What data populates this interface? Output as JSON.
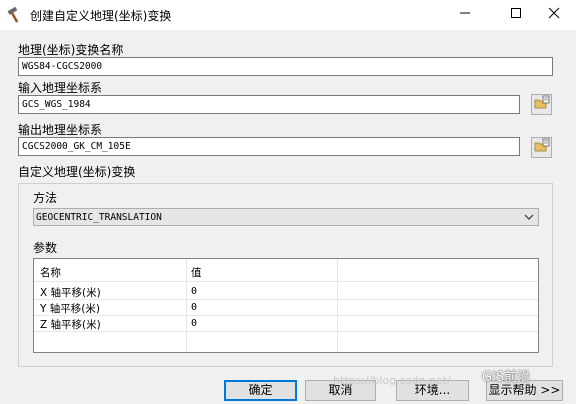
{
  "window": {
    "title": "创建自定义地理(坐标)变换"
  },
  "form": {
    "name_label": "地理(坐标)变换名称",
    "name_value": "WGS84-CGCS2000",
    "input_label": "输入地理坐标系",
    "input_value": "GCS_WGS_1984",
    "output_label": "输出地理坐标系",
    "output_value": "CGCS2000_GK_CM_105E",
    "custom_section_label": "自定义地理(坐标)变换",
    "method_label": "方法",
    "method_value": "GEOCENTRIC_TRANSLATION",
    "params_label": "参数"
  },
  "params_table": {
    "headers": [
      "名称",
      "值"
    ],
    "rows": [
      {
        "name": "X 轴平移(米)",
        "value": "0"
      },
      {
        "name": "Y 轴平移(米)",
        "value": "0"
      },
      {
        "name": "Z 轴平移(米)",
        "value": "0"
      }
    ]
  },
  "buttons": {
    "ok": "确定",
    "cancel": "取消",
    "env": "环境...",
    "help": "显示帮助 >>"
  },
  "watermark": {
    "url_text": "https://blog.csdn.net/",
    "wechat_text": "GIS前沿"
  }
}
